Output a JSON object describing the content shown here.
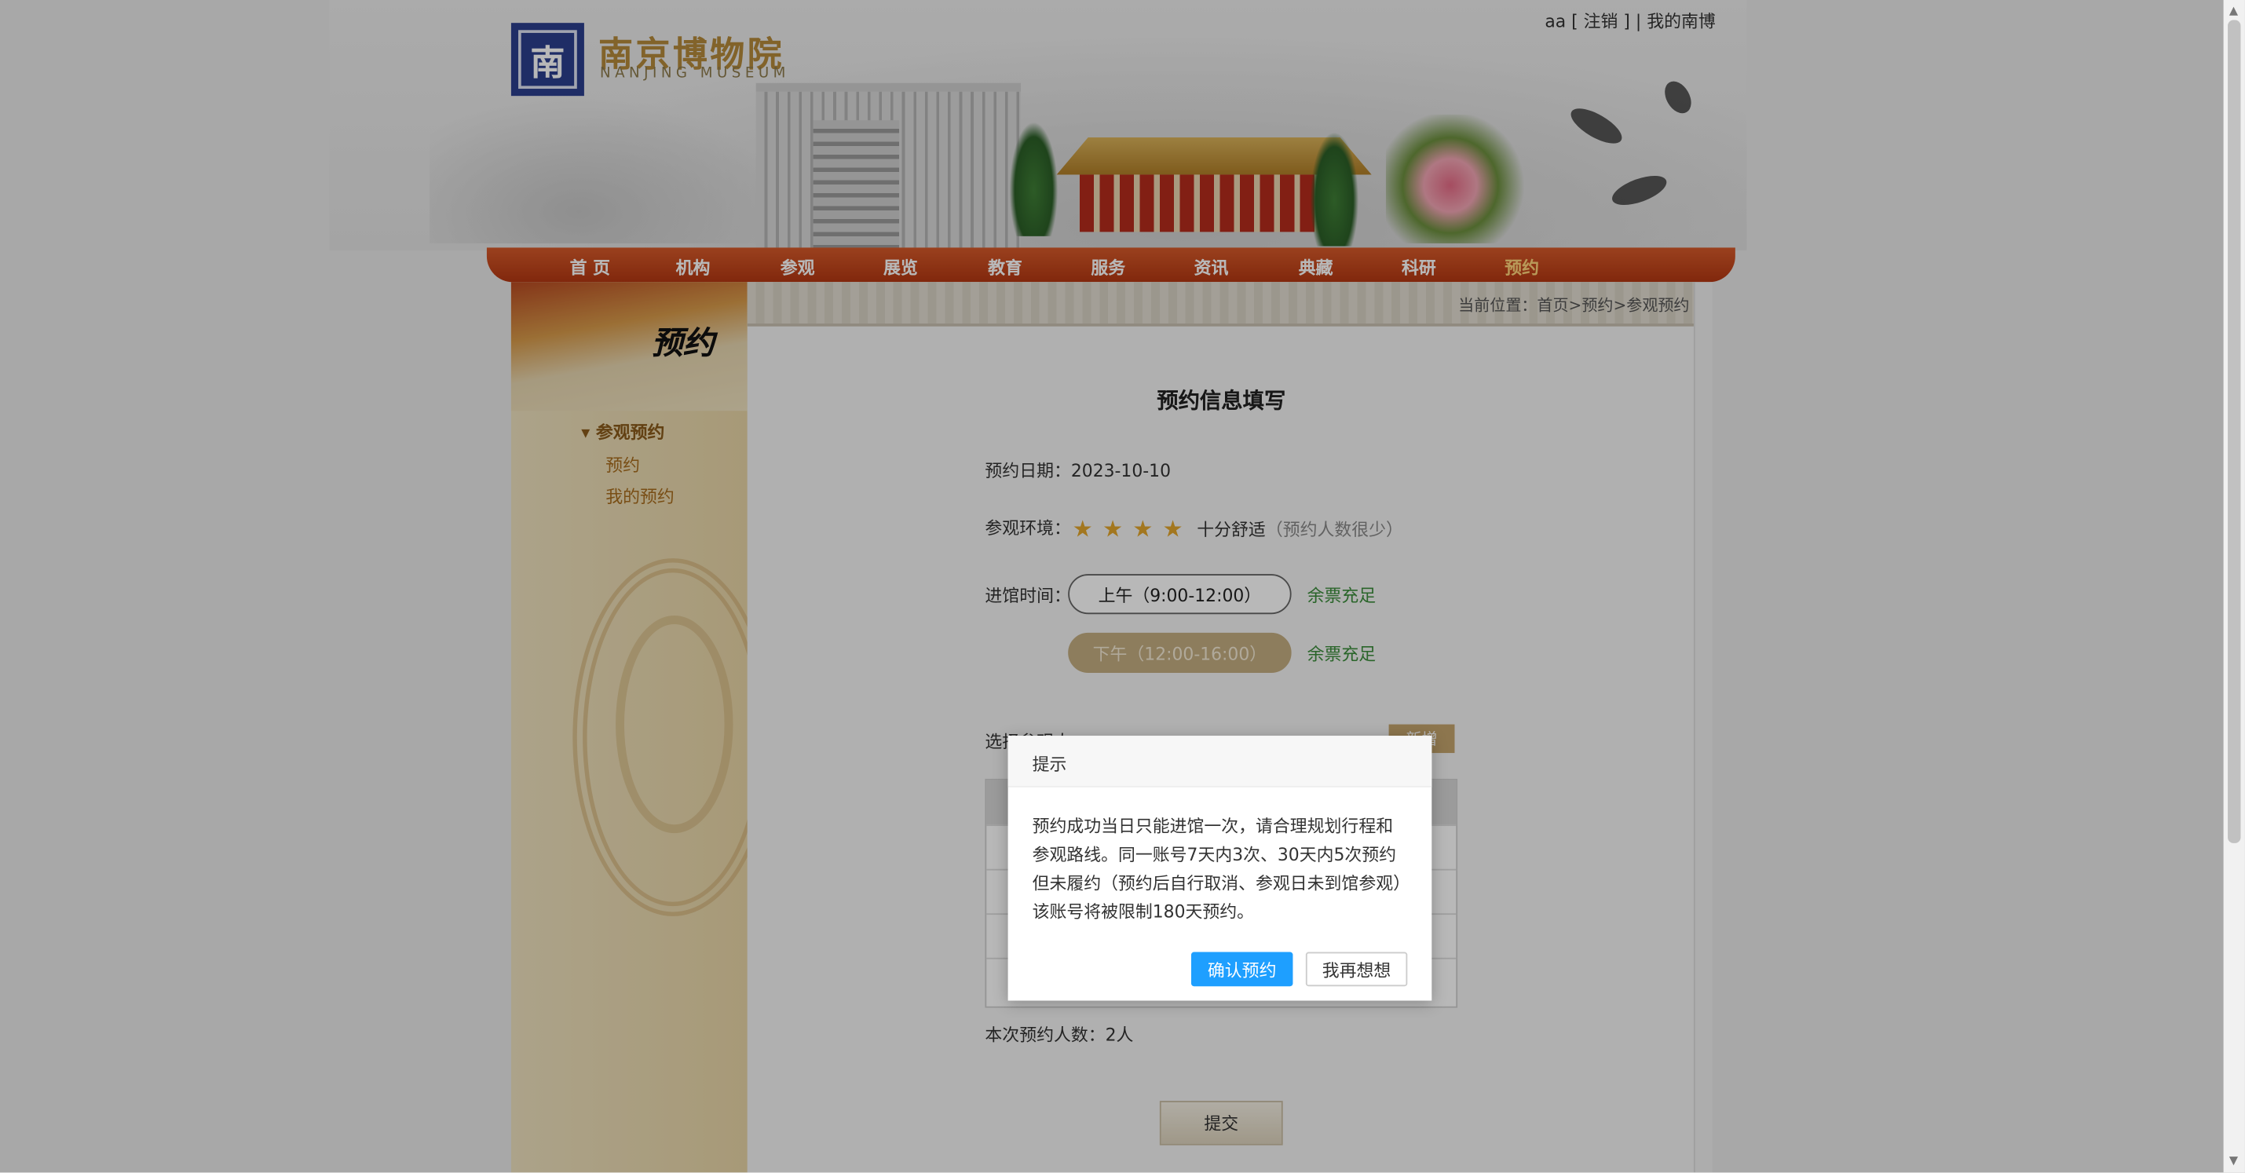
{
  "header": {
    "logo_char": "南",
    "logo_cn": "南京博物院",
    "logo_en": "NANJING MUSEUM",
    "user_name": "aa",
    "logout": "[ 注销 ]",
    "separator": "|",
    "my_museum": "我的南博"
  },
  "nav": {
    "items": [
      "首 页",
      "机构",
      "参观",
      "展览",
      "教育",
      "服务",
      "资讯",
      "典藏",
      "科研",
      "预约"
    ],
    "active": "预约"
  },
  "sidebar": {
    "title": "预约",
    "category": "参观预约",
    "links": [
      "预约",
      "我的预约"
    ]
  },
  "breadcrumb": "当前位置：首页>预约>参观预约",
  "form": {
    "title": "预约信息填写",
    "date_label": "预约日期：",
    "date_value": "2023-10-10",
    "env_label": "参观环境：",
    "stars": 4,
    "env_text": "十分舒适",
    "env_note": "（预约人数很少）",
    "time_label": "进馆时间：",
    "am_slot": "上午（9:00-12:00）",
    "pm_slot": "下午（12:00-16:00）",
    "am_status": "余票充足",
    "pm_status": "余票充足",
    "visitor_label": "选择参观人",
    "add_button": "新增",
    "count_label": "本次预约人数：2人",
    "submit": "提交"
  },
  "modal": {
    "title": "提示",
    "body": "预约成功当日只能进馆一次，请合理规划行程和参观路线。同一账号7天内3次、30天内5次预约但未履约（预约后自行取消、参观日未到馆参观）该账号将被限制180天预约。",
    "confirm": "确认预约",
    "cancel": "我再想想"
  },
  "colors": {
    "nav_red": "#c2421a",
    "confirm_blue": "#1e9fff",
    "available_green": "#3b8c3b",
    "sidebar_tan": "#efe2bf"
  }
}
